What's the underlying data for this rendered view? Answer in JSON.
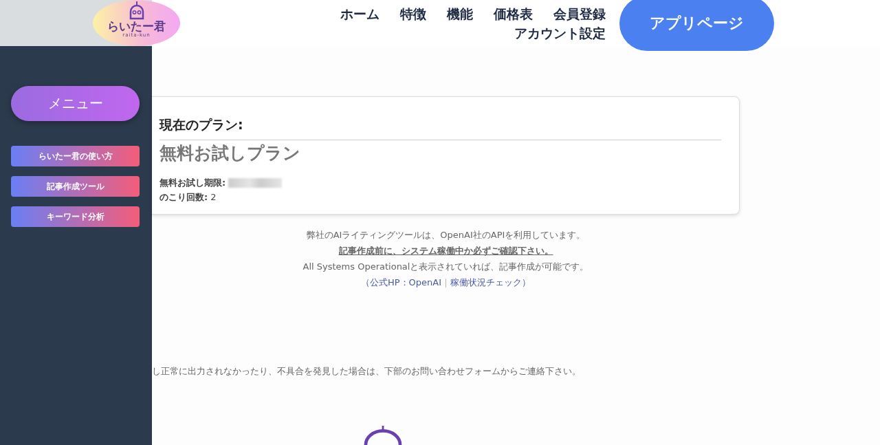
{
  "logo": {
    "title": "らいたー君",
    "subtitle": "raita-kun"
  },
  "nav": [
    {
      "label": "ホーム"
    },
    {
      "label": "特徴"
    },
    {
      "label": "機能"
    },
    {
      "label": "価格表"
    },
    {
      "label": "会員登録"
    },
    {
      "label": "アカウント設定"
    }
  ],
  "app_button": "アプリページ",
  "sidebar": {
    "menu_button": "メニュー",
    "items": [
      {
        "label": "らいたー君の使い方"
      },
      {
        "label": "記事作成ツール"
      },
      {
        "label": "キーワード分析"
      }
    ]
  },
  "plan_card": {
    "heading": "現在のプラン:",
    "plan_name": "無料お試しプラン",
    "details": [
      {
        "kind": "redacted",
        "label": "無料お試し期限:"
      },
      {
        "kind": "text",
        "label": "のこり回数:",
        "value": "2"
      }
    ]
  },
  "notice": [
    {
      "kind": "plain",
      "text": "弊社のAIライティングツールは、OpenAI社のAPIを利用しています。"
    },
    {
      "kind": "underlined",
      "text": "記事作成前に、システム稼働中か必ずご確認下さい。"
    },
    {
      "kind": "plain",
      "text": "All Systems Operationalと表示されていれば、記事作成が可能です。"
    },
    {
      "kind": "links",
      "prefix": "（公式HP：",
      "links": [
        "OpenAI",
        "稼働状況チェック"
      ],
      "separator": "｜",
      "suffix": "）"
    }
  ],
  "footer_message": "し正常に出力されなかったり、不具合を発見した場合は、下部のお問い合わせフォームからご連絡下さい。"
}
